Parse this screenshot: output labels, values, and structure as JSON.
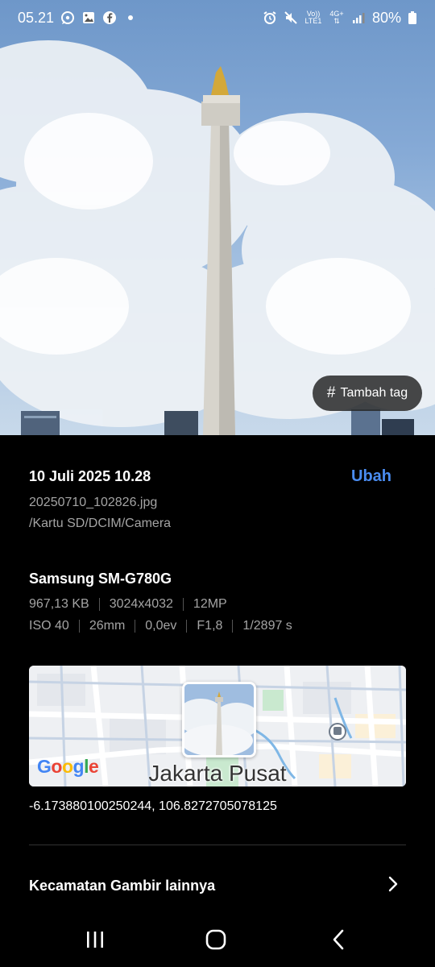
{
  "status_bar": {
    "time": "05.21",
    "notifications": [
      "whatsapp-icon",
      "gallery-icon",
      "facebook-icon",
      "dot-icon"
    ],
    "indicators": [
      "alarm-icon",
      "mute-icon",
      "volte-icon",
      "4g-icon",
      "signal-icon"
    ],
    "volte_label_top": "Vo))",
    "volte_label_bottom": "LTE1",
    "network_label": "4G+",
    "battery_percent": "80%"
  },
  "photo": {
    "tag_button_label": "Tambah tag"
  },
  "details": {
    "datetime": "10 Juli 2025 10.28",
    "edit_label": "Ubah",
    "filename": "20250710_102826.jpg",
    "path": "/Kartu SD/DCIM/Camera",
    "device": "Samsung SM-G780G",
    "specs_row1": [
      "967,13 KB",
      "3024x4032",
      "12MP"
    ],
    "specs_row2": [
      "ISO 40",
      "26mm",
      "0,0ev",
      "F1,8",
      "1/2897 s"
    ]
  },
  "map": {
    "place_label": "Jakarta Pusat",
    "logo_text": "Google",
    "coordinates": "-6.173880100250244, 106.8272705078125"
  },
  "more": {
    "label": "Kecamatan Gambir lainnya"
  },
  "colors": {
    "accent": "#4a8cf0",
    "background": "#000000",
    "muted_text": "#a4a4a4"
  }
}
